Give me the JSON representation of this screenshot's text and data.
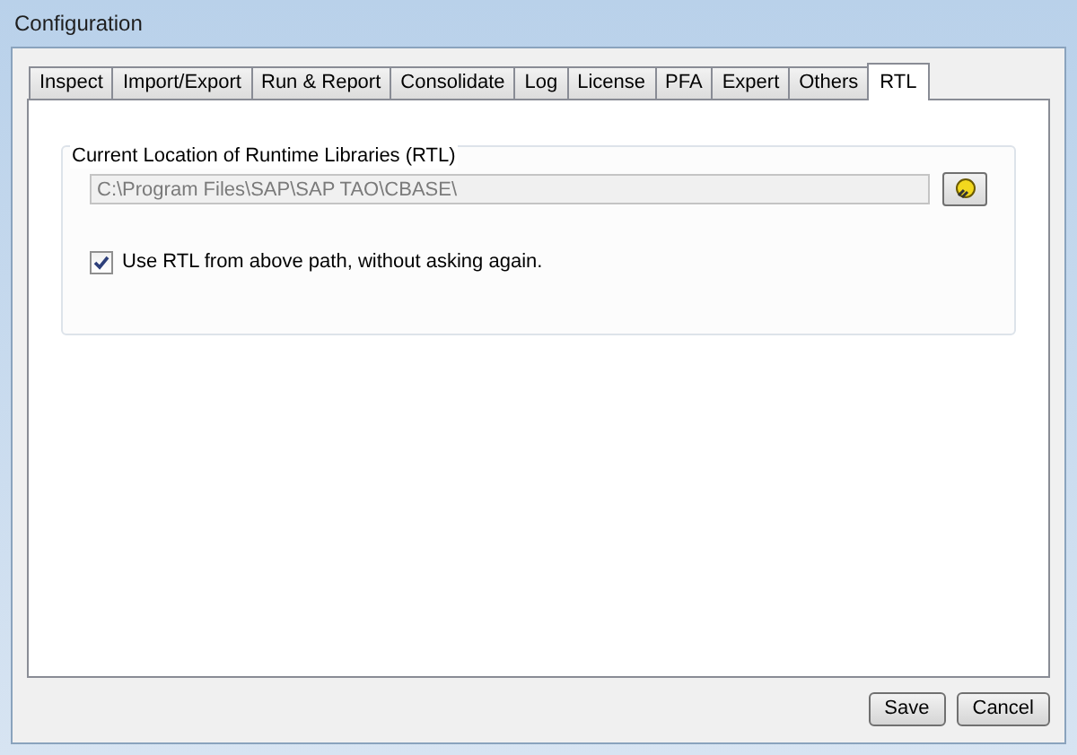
{
  "window": {
    "title": "Configuration"
  },
  "tabs": [
    {
      "label": "Inspect",
      "selected": false
    },
    {
      "label": "Import/Export",
      "selected": false
    },
    {
      "label": "Run & Report",
      "selected": false
    },
    {
      "label": "Consolidate",
      "selected": false
    },
    {
      "label": "Log",
      "selected": false
    },
    {
      "label": "License",
      "selected": false
    },
    {
      "label": "PFA",
      "selected": false
    },
    {
      "label": "Expert",
      "selected": false
    },
    {
      "label": "Others",
      "selected": false
    },
    {
      "label": "RTL",
      "selected": true
    }
  ],
  "group": {
    "title": "Current Location of Runtime Libraries (RTL)",
    "path": {
      "value": "C:\\Program Files\\SAP\\SAP TAO\\CBASE\\",
      "disabled": true
    },
    "checkbox": {
      "label": "Use RTL from above path, without asking again.",
      "checked": true
    }
  },
  "buttons": [
    "Save",
    "Cancel"
  ]
}
